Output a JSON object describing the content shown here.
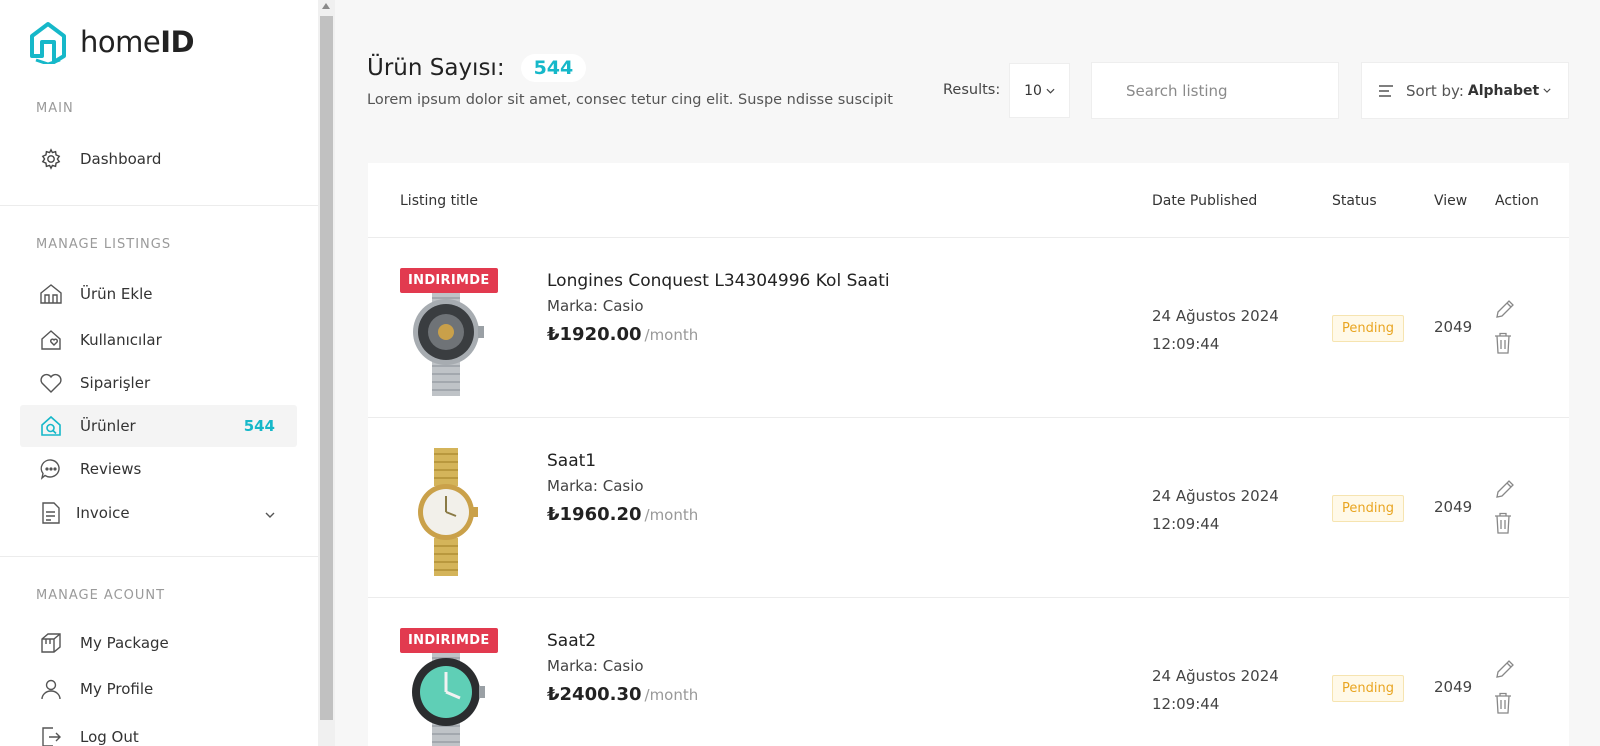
{
  "app": {
    "logo_prefix": "home",
    "logo_bold": "ID"
  },
  "sidebar": {
    "main_label": "MAIN",
    "dashboard": "Dashboard",
    "manage_listings_label": "MANAGE LISTINGS",
    "items": [
      {
        "label": "Ürün Ekle",
        "icon": "house-icon"
      },
      {
        "label": "Kullanıcılar",
        "icon": "house-heart-icon"
      },
      {
        "label": "Siparişler",
        "icon": "heart-icon"
      },
      {
        "label": "Ürünler",
        "icon": "house-search-icon",
        "count": "544",
        "active": true
      },
      {
        "label": "Reviews",
        "icon": "chat-icon"
      },
      {
        "label": "Invoice",
        "icon": "invoice-icon"
      }
    ],
    "manage_account_label": "MANAGE ACOUNT",
    "account_items": [
      {
        "label": "My Package",
        "icon": "package-icon"
      },
      {
        "label": "My Profile",
        "icon": "user-icon"
      },
      {
        "label": "Log Out",
        "icon": "logout-icon"
      }
    ]
  },
  "header": {
    "title": "Ürün Sayısı:",
    "count": "544",
    "subtitle": "Lorem ipsum dolor sit amet, consec tetur cing elit. Suspe ndisse suscipit",
    "results_label": "Results:",
    "results_value": "10",
    "search_placeholder": "Search listing",
    "sort_label": "Sort by:",
    "sort_value": "Alphabet"
  },
  "table": {
    "columns": [
      "Listing title",
      "Date Published",
      "Status",
      "View",
      "Action"
    ],
    "rows": [
      {
        "tag": "INDIRIMDE",
        "title": "Longines Conquest L34304996 Kol Saati",
        "brand": "Marka: Casio",
        "price": "₺1920.00",
        "period": "/month",
        "date": "24 Ağustos 2024",
        "time": "12:09:44",
        "status": "Pending",
        "views": "2049"
      },
      {
        "tag": "",
        "title": "Saat1",
        "brand": "Marka: Casio",
        "price": "₺1960.20",
        "period": "/month",
        "date": "24 Ağustos 2024",
        "time": "12:09:44",
        "status": "Pending",
        "views": "2049"
      },
      {
        "tag": "INDIRIMDE",
        "title": "Saat2",
        "brand": "Marka: Casio",
        "price": "₺2400.30",
        "period": "/month",
        "date": "24 Ağustos 2024",
        "time": "12:09:44",
        "status": "Pending",
        "views": "2049"
      }
    ]
  },
  "colors": {
    "accent": "#16b8c9",
    "tag": "#e23a4f",
    "pending": "#e9a521"
  }
}
